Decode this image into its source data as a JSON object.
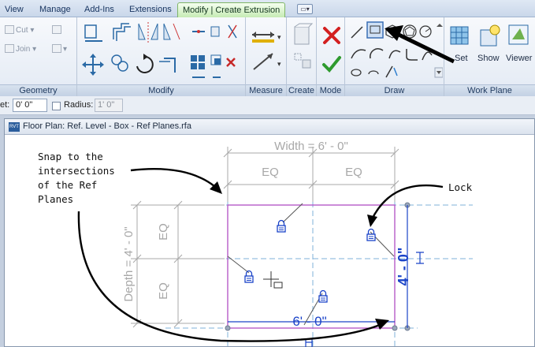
{
  "tabs": [
    "View",
    "Manage",
    "Add-Ins",
    "Extensions",
    "Modify | Create Extrusion"
  ],
  "ribbon": {
    "geometry": {
      "label": "Geometry",
      "cut": "Cut",
      "join": "Join"
    },
    "modify": {
      "label": "Modify"
    },
    "measure": {
      "label": "Measure"
    },
    "create": {
      "label": "Create"
    },
    "mode": {
      "label": "Mode"
    },
    "draw": {
      "label": "Draw"
    },
    "work_plane": {
      "label": "Work Plane",
      "set": "Set",
      "show": "Show",
      "viewer": "Viewer"
    }
  },
  "options_bar": {
    "prefix": "et:",
    "offset_value": "0' 0\"",
    "radius_label": "Radius:",
    "radius_value": "1' 0\""
  },
  "view": {
    "title": "Floor Plan: Ref. Level - Box - Ref Planes.rfa",
    "file_badge": "RVT"
  },
  "drawing": {
    "width_dim": "Width = 6' - 0\"",
    "depth_dim": "Depth = 4' - 0\"",
    "eq": "EQ",
    "height_value": "4' - 0\"",
    "bottom_value": "6' - 0\""
  },
  "annotations": {
    "snap_lines": [
      "Snap to the",
      "intersections",
      "of the Ref",
      "Planes"
    ],
    "lock": "Lock"
  },
  "colors": {
    "tab_active": "#c6ebb4",
    "sketch_line": "#b04fc4",
    "dimension_blue": "#1a43c8",
    "ref_plane": "#7fb2d8",
    "grey_dim": "#a8a8a8"
  },
  "icons": [
    "cut-icon",
    "join-icon",
    "move-icon",
    "rotate-icon",
    "align-icon",
    "offset-icon",
    "mirror-icon",
    "split-icon",
    "copy-icon",
    "trim-icon",
    "delete-icon",
    "measure-icon",
    "create-icon",
    "cancel-icon",
    "finish-icon",
    "line-icon",
    "rectangle-icon",
    "polygon-icon",
    "circle-icon",
    "arc-icon",
    "pick-icon",
    "set-icon",
    "show-icon",
    "viewer-icon",
    "lock-icon",
    "cursor-icon"
  ]
}
